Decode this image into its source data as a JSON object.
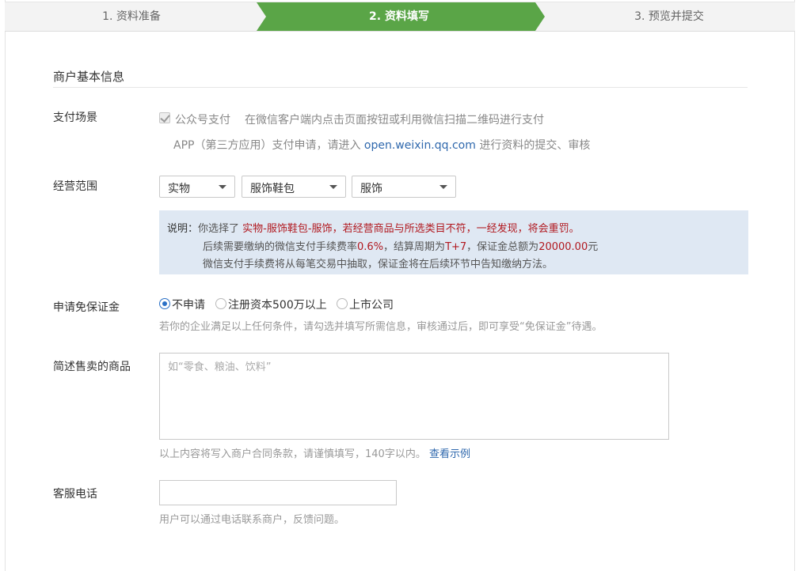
{
  "steps": [
    {
      "label": "1. 资料准备"
    },
    {
      "label": "2. 资料填写"
    },
    {
      "label": "3. 预览并提交"
    }
  ],
  "colors": {
    "active_step": "#5aa547",
    "link": "#2f68ad",
    "highlight": "#b1181f",
    "notice_bg": "#dfe8f3"
  },
  "section": {
    "title": "商户基本信息"
  },
  "payment_scene": {
    "label": "支付场景",
    "option_label": "公众号支付",
    "option_checked": true,
    "option_desc": "在微信客户端内点击页面按钮或利用微信扫描二维码进行支付",
    "app_note_prefix": "APP（第三方应用）支付申请，请进入",
    "app_note_link": "open.weixin.qq.com",
    "app_note_suffix": "进行资料的提交、审核"
  },
  "business_scope": {
    "label": "经营范围",
    "select1": "实物",
    "select2": "服饰鞋包",
    "select3": "服饰",
    "notice": {
      "title": "说明：",
      "line1_prefix": "你选择了",
      "line1_selection": "实物-服饰鞋包-服饰",
      "line1_warning": "，若经营商品与所选类目不符，一经发现，将会重罚。",
      "line2_a": "后续需要缴纳的微信支付手续费率",
      "line2_rate": "0.6%",
      "line2_b": "，结算周期为",
      "line2_period": "T+7",
      "line2_c": "，保证金总额为",
      "line2_deposit": "20000.00",
      "line2_unit": "元",
      "line3": "微信支付手续费将从每笔交易中抽取，保证金将在后续环节中告知缴纳方法。"
    }
  },
  "deposit_exemption": {
    "label": "申请免保证金",
    "options": [
      {
        "label": "不申请",
        "checked": true
      },
      {
        "label": "注册资本500万以上",
        "checked": false
      },
      {
        "label": "上市公司",
        "checked": false
      }
    ],
    "hint": "若你的企业满足以上任何条件，请勾选并填写所需信息，审核通过后，即可享受“免保证金”待遇。"
  },
  "goods": {
    "label": "简述售卖的商品",
    "placeholder": "如“零食、粮油、饮料”",
    "hint_prefix": "以上内容将写入商户合同条款，请谨慎填写，140字以内。",
    "hint_link": "查看示例"
  },
  "phone": {
    "label": "客服电话",
    "value": "",
    "hint": "用户可以通过电话联系商户，反馈问题。"
  }
}
